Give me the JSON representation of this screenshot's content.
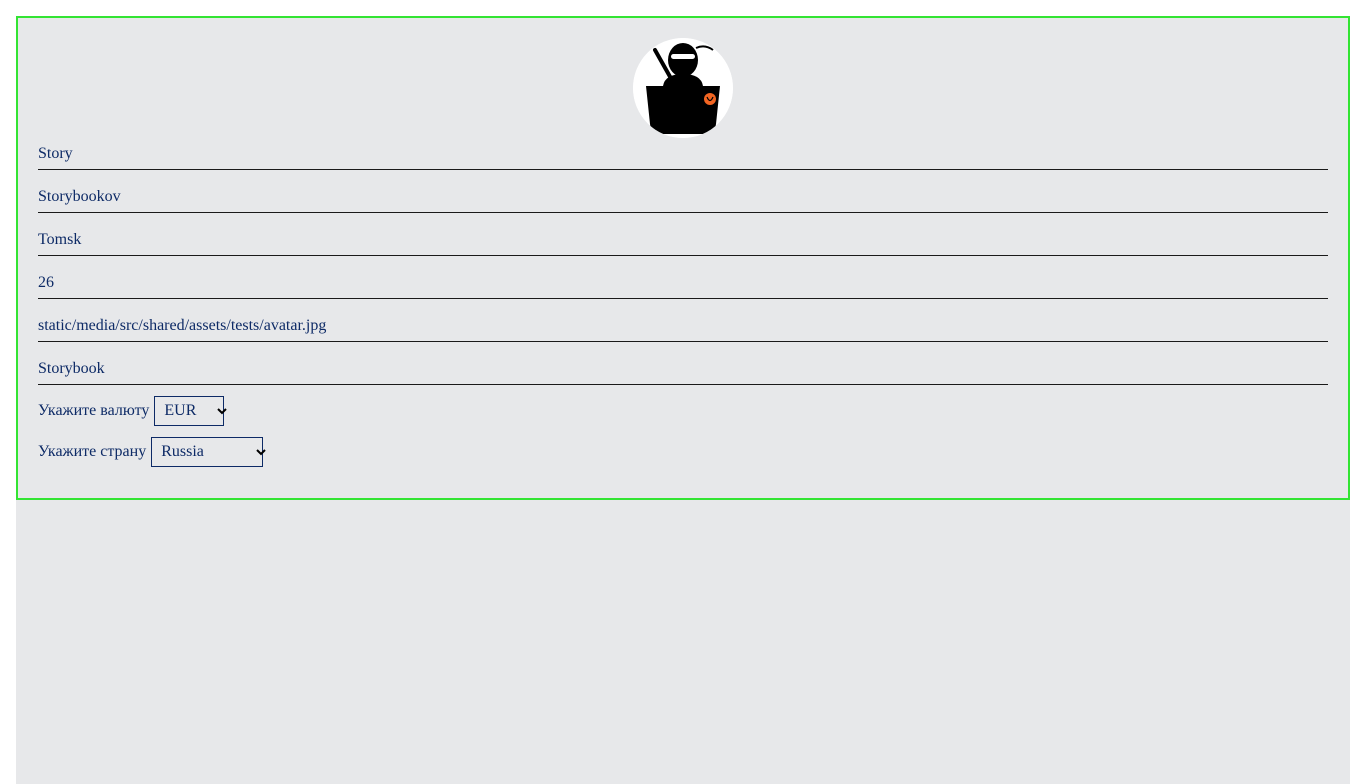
{
  "profile": {
    "first_name": "Story",
    "last_name": "Storybookov",
    "city": "Tomsk",
    "age": "26",
    "avatar_path": "static/media/src/shared/assets/tests/avatar.jpg",
    "username": "Storybook"
  },
  "currency": {
    "label": "Укажите валюту",
    "selected": "EUR"
  },
  "country": {
    "label": "Укажите страну",
    "selected": "Russia"
  },
  "colors": {
    "card_border": "#33e433",
    "background": "#e7e8ea",
    "text": "#0d2a66"
  },
  "icons": {
    "avatar": "ninja-avatar-icon",
    "dropdown": "chevron-down-icon"
  }
}
